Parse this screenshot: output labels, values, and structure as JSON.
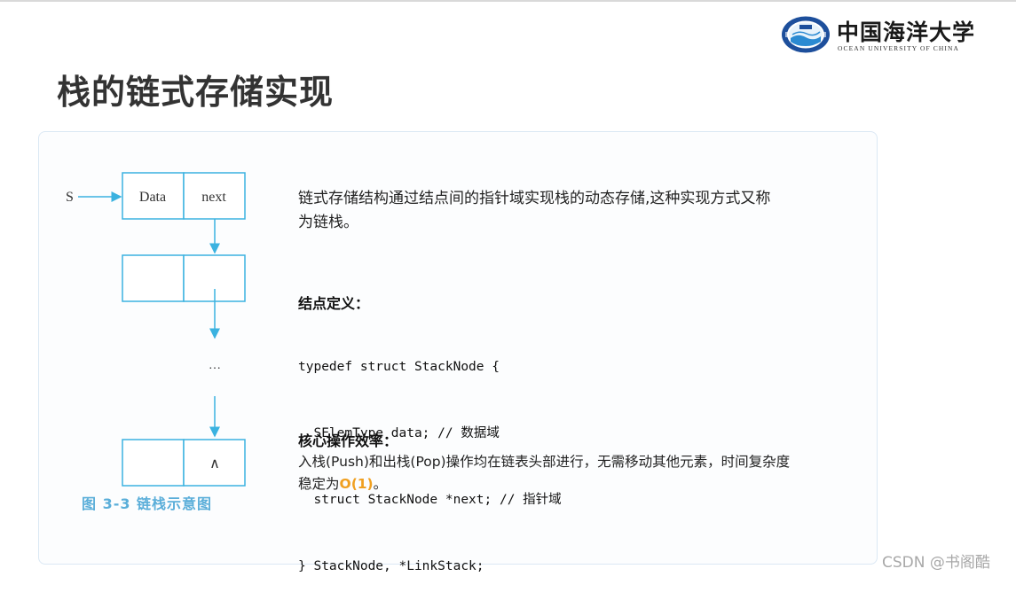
{
  "logo": {
    "chinese_name": "中国海洋大学",
    "english_name": "OCEAN UNIVERSITY OF CHINA",
    "seal_colors": [
      "#1d4f9c",
      "#2a8ad2",
      "#e8f3fb"
    ]
  },
  "slide": {
    "title": "栈的链式存储实现"
  },
  "diagram": {
    "pointer_label": "S",
    "node1_data": "Data",
    "node1_next": "next",
    "ellipsis": "…",
    "tail_symbol": "∧",
    "caption": "图 3-3    链栈示意图",
    "line_color": "#3bb2e0"
  },
  "content": {
    "intro_line1": "链式存储结构通过结点间的指针域实现栈的动态存储,这种实现方式又称",
    "intro_line2": "为链栈。",
    "def_heading": "结点定义：",
    "code_lines": [
      "typedef struct StackNode {",
      "  SElemType data; // 数据域",
      "  struct StackNode *next; // 指针域",
      "} StackNode, *LinkStack;"
    ],
    "eff_heading": "核心操作效率：",
    "eff_line1": "入栈(Push)和出栈(Pop)操作均在链表头部进行，无需移动其他元素，时间复杂度",
    "eff_line2_prefix": "稳定为",
    "eff_big_o": "O(1)",
    "eff_line2_suffix": "。",
    "accent_color": "#f0a020"
  },
  "watermark": "CSDN @书阁酷"
}
